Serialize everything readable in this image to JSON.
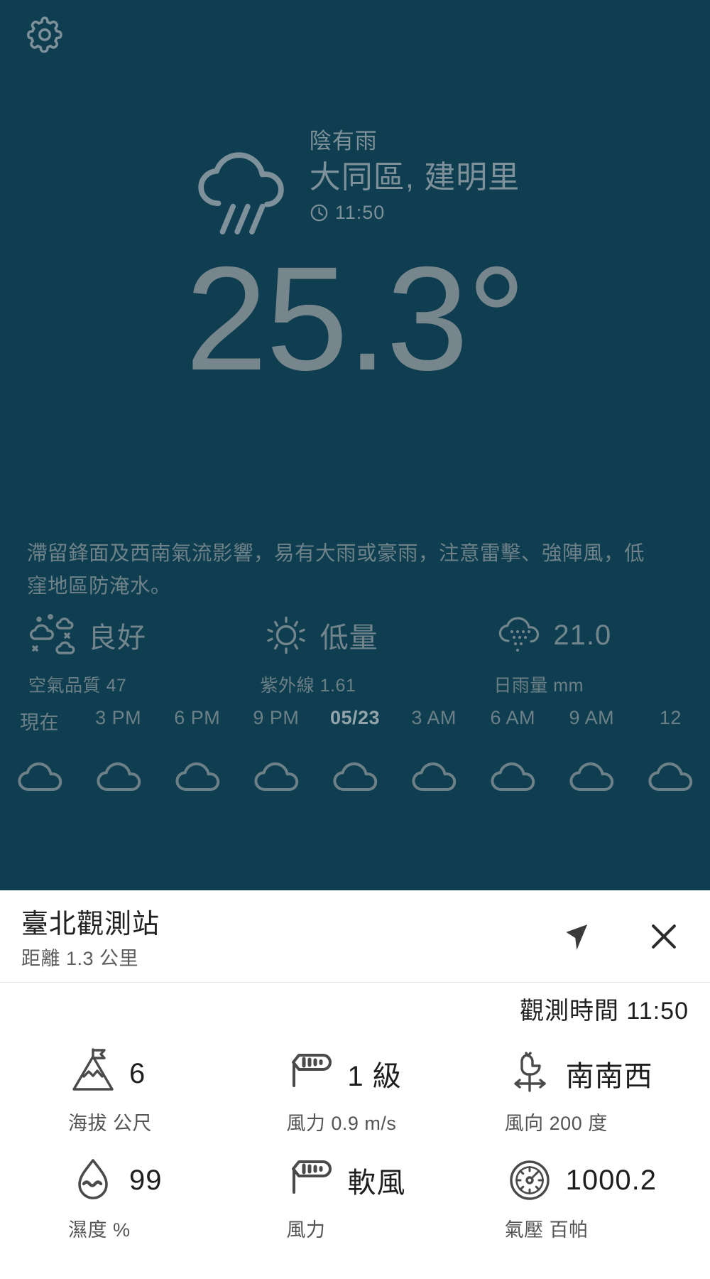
{
  "theme": {
    "bg": "#0e3e50",
    "muted_text": "#7e9099",
    "sheet_bg": "#ffffff",
    "sheet_text": "#1e1e1e",
    "sheet_sub_text": "#545454"
  },
  "topbar": {
    "settings_icon": "gear-icon"
  },
  "current": {
    "condition": "陰有雨",
    "location": "大同區, 建明里",
    "time_icon": "clock-icon",
    "time": "11:50",
    "weather_icon": "cloud-rain-icon",
    "temperature": "25.3°"
  },
  "alert": {
    "text": "滯留鋒面及西南氣流影響，易有大雨或豪雨，注意雷擊、強陣風，低窪地區防淹水。"
  },
  "metrics": [
    {
      "icon": "air-quality-icon",
      "value": "良好",
      "sub": "空氣品質 47"
    },
    {
      "icon": "sun-icon",
      "value": "低量",
      "sub": "紫外線 1.61"
    },
    {
      "icon": "rain-cloud-icon",
      "value": "21.0",
      "sub": "日雨量 mm"
    }
  ],
  "timeline": [
    {
      "label": "現在",
      "strong": false
    },
    {
      "label": "3 PM",
      "strong": false
    },
    {
      "label": "6 PM",
      "strong": false
    },
    {
      "label": "9 PM",
      "strong": false
    },
    {
      "label": "05/23",
      "strong": true
    },
    {
      "label": "3 AM",
      "strong": false
    },
    {
      "label": "6 AM",
      "strong": false
    },
    {
      "label": "9 AM",
      "strong": false
    },
    {
      "label": "12",
      "strong": false
    }
  ],
  "sheet": {
    "station_name": "臺北觀測站",
    "distance": "距離 1.3 公里",
    "navigate_icon": "navigation-arrow-icon",
    "close_icon": "close-icon",
    "observation_time": "觀測時間 11:50",
    "cells": [
      {
        "icon": "mountain-flag-icon",
        "value": "6",
        "sub": "海拔 公尺"
      },
      {
        "icon": "windsock-icon",
        "value": "1 級",
        "sub": "風力 0.9 m/s"
      },
      {
        "icon": "weather-vane-icon",
        "value": "南南西",
        "sub": "風向 200 度"
      },
      {
        "icon": "humidity-drop-icon",
        "value": "99",
        "sub": "濕度 %"
      },
      {
        "icon": "windsock-icon",
        "value": "軟風",
        "sub": "風力"
      },
      {
        "icon": "pressure-gauge-icon",
        "value": "1000.2",
        "sub": "氣壓 百帕"
      }
    ]
  }
}
